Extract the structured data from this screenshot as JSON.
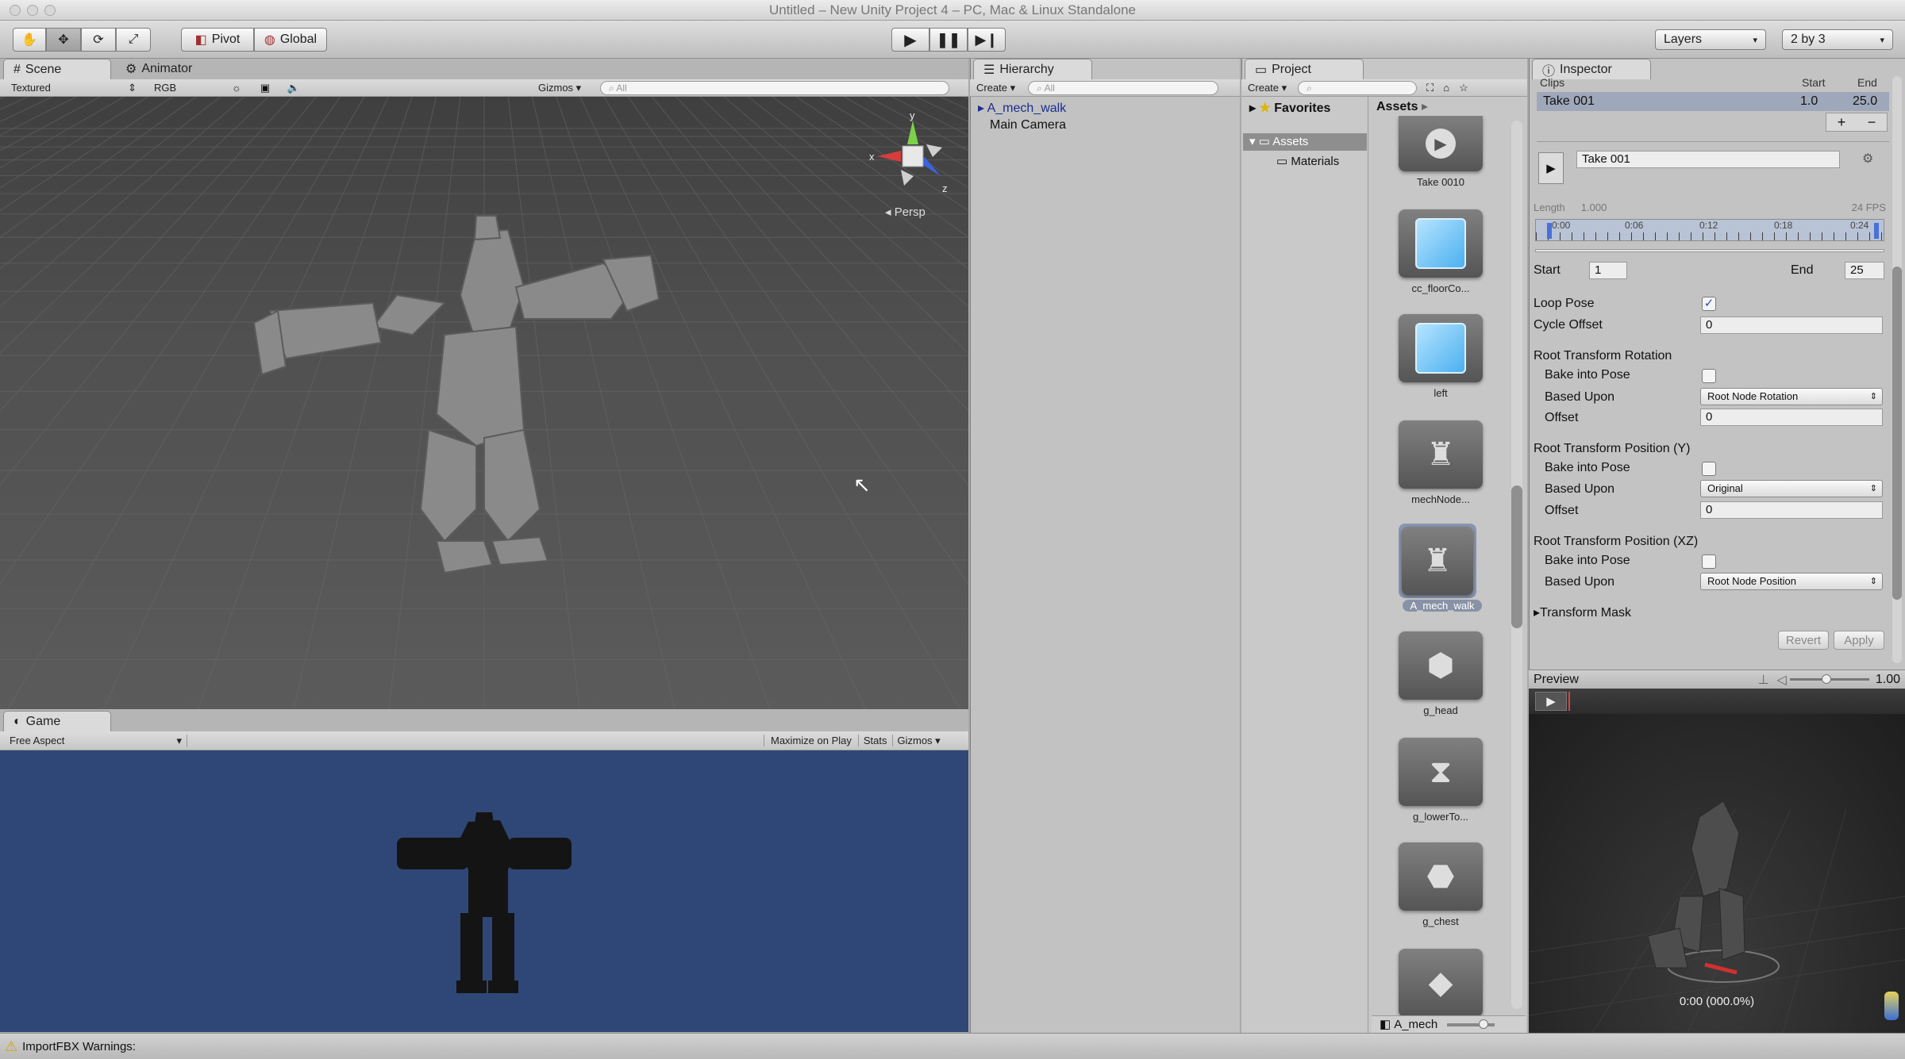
{
  "window": {
    "title": "Untitled – New Unity Project 4 – PC, Mac & Linux Standalone"
  },
  "toolbar": {
    "pivot_label": "Pivot",
    "global_label": "Global",
    "layers_label": "Layers",
    "layout_label": "2 by 3",
    "tools": [
      "hand-icon",
      "move-icon",
      "rotate-icon",
      "scale-icon"
    ],
    "play": [
      "play-icon",
      "pause-icon",
      "step-icon"
    ]
  },
  "scene": {
    "tab_scene": "Scene",
    "tab_animator": "Animator",
    "render_mode": "Textured",
    "color_mode": "RGB",
    "gizmos_label": "Gizmos",
    "search_placeholder": "All",
    "persp_label": "Persp",
    "axis_y": "y",
    "axis_x": "x",
    "axis_z": "z"
  },
  "game": {
    "tab_label": "Game",
    "aspect": "Free Aspect",
    "maximize_label": "Maximize on Play",
    "stats_label": "Stats",
    "gizmos_label": "Gizmos"
  },
  "hierarchy": {
    "tab_label": "Hierarchy",
    "create_label": "Create",
    "search_placeholder": "All",
    "items": [
      "A_mech_walk",
      "Main Camera"
    ]
  },
  "project": {
    "tab_label": "Project",
    "create_label": "Create",
    "favorites_label": "Favorites",
    "tree": [
      "Assets",
      "Materials"
    ],
    "breadcrumb": "Assets",
    "assets": [
      "Take 0010",
      "cc_floorCo...",
      "left",
      "mechNode...",
      "A_mech_walk",
      "g_head",
      "g_lowerTo...",
      "g_chest"
    ],
    "footer_label": "A_mech"
  },
  "inspector": {
    "tab_label": "Inspector",
    "clips_header": "Clips",
    "start_header": "Start",
    "end_header": "End",
    "clip_name": "Take 001",
    "clip_start": "1.0",
    "clip_end": "25.0",
    "plus": "+",
    "minus": "−",
    "name_value": "Take 001",
    "length_label": "Length",
    "length_value": "1.000",
    "fps_label": "24 FPS",
    "timeline_ticks": [
      "0:00",
      "0:06",
      "0:12",
      "0:18",
      "0:24"
    ],
    "start_label": "Start",
    "start_value": "1",
    "end_label": "End",
    "end_value": "25",
    "loop_pose_label": "Loop Pose",
    "loop_pose_checked": "✓",
    "cycle_offset_label": "Cycle Offset",
    "cycle_offset_value": "0",
    "rot_section": "Root Transform Rotation",
    "pos_y_section": "Root Transform Position (Y)",
    "pos_xz_section": "Root Transform Position (XZ)",
    "bake_label": "Bake into Pose",
    "based_label": "Based Upon",
    "offset_label": "Offset",
    "rot_based_value": "Root Node Rotation",
    "rot_offset_value": "0",
    "y_based_value": "Original",
    "y_offset_value": "0",
    "xz_based_value": "Root Node Position",
    "mask_label": "Transform Mask",
    "revert_label": "Revert",
    "apply_label": "Apply"
  },
  "preview": {
    "title": "Preview",
    "speed": "1.00",
    "time_readout": "0:00 (000.0%)"
  },
  "statusbar": {
    "message": "ImportFBX Warnings:"
  }
}
